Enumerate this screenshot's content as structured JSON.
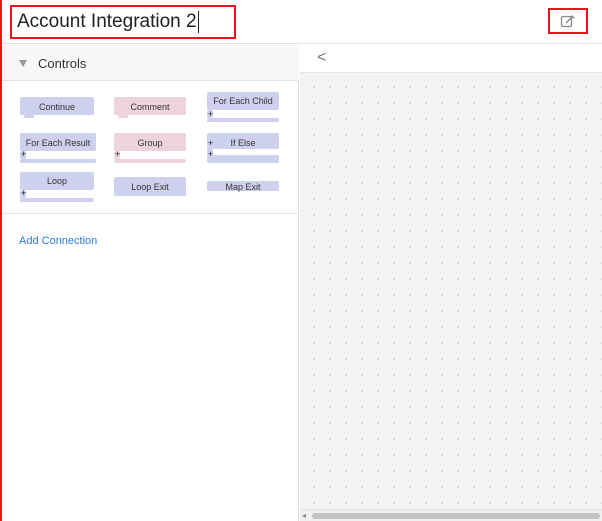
{
  "header": {
    "title": "Account Integration 2",
    "edit_icon": "edit-icon"
  },
  "controls": {
    "heading": "Controls",
    "blocks": [
      {
        "label": "Continue",
        "color": "#cdd1ee"
      },
      {
        "label": "Comment",
        "color": "#ecd3dc"
      },
      {
        "label": "For Each Child",
        "color": "#cdd1ee"
      },
      {
        "label": "For Each Result",
        "color": "#cdd1ee"
      },
      {
        "label": "Group",
        "color": "#ecd3dc"
      },
      {
        "label": "If Else",
        "color": "#cdd1ee"
      },
      {
        "label": "Loop",
        "color": "#cdd1ee"
      },
      {
        "label": "Loop Exit",
        "color": "#cdd1ee"
      },
      {
        "label": "Map Exit",
        "color": "#cdd1ee"
      }
    ],
    "plus_symbol": "+"
  },
  "connections": {
    "add_label": "Add Connection"
  },
  "canvas": {
    "collapse_symbol": "<"
  },
  "colors": {
    "highlight": "#e8141a",
    "link": "#2a7bd8",
    "block_blue": "#cdd1ee",
    "block_pink": "#ecd3dc"
  }
}
